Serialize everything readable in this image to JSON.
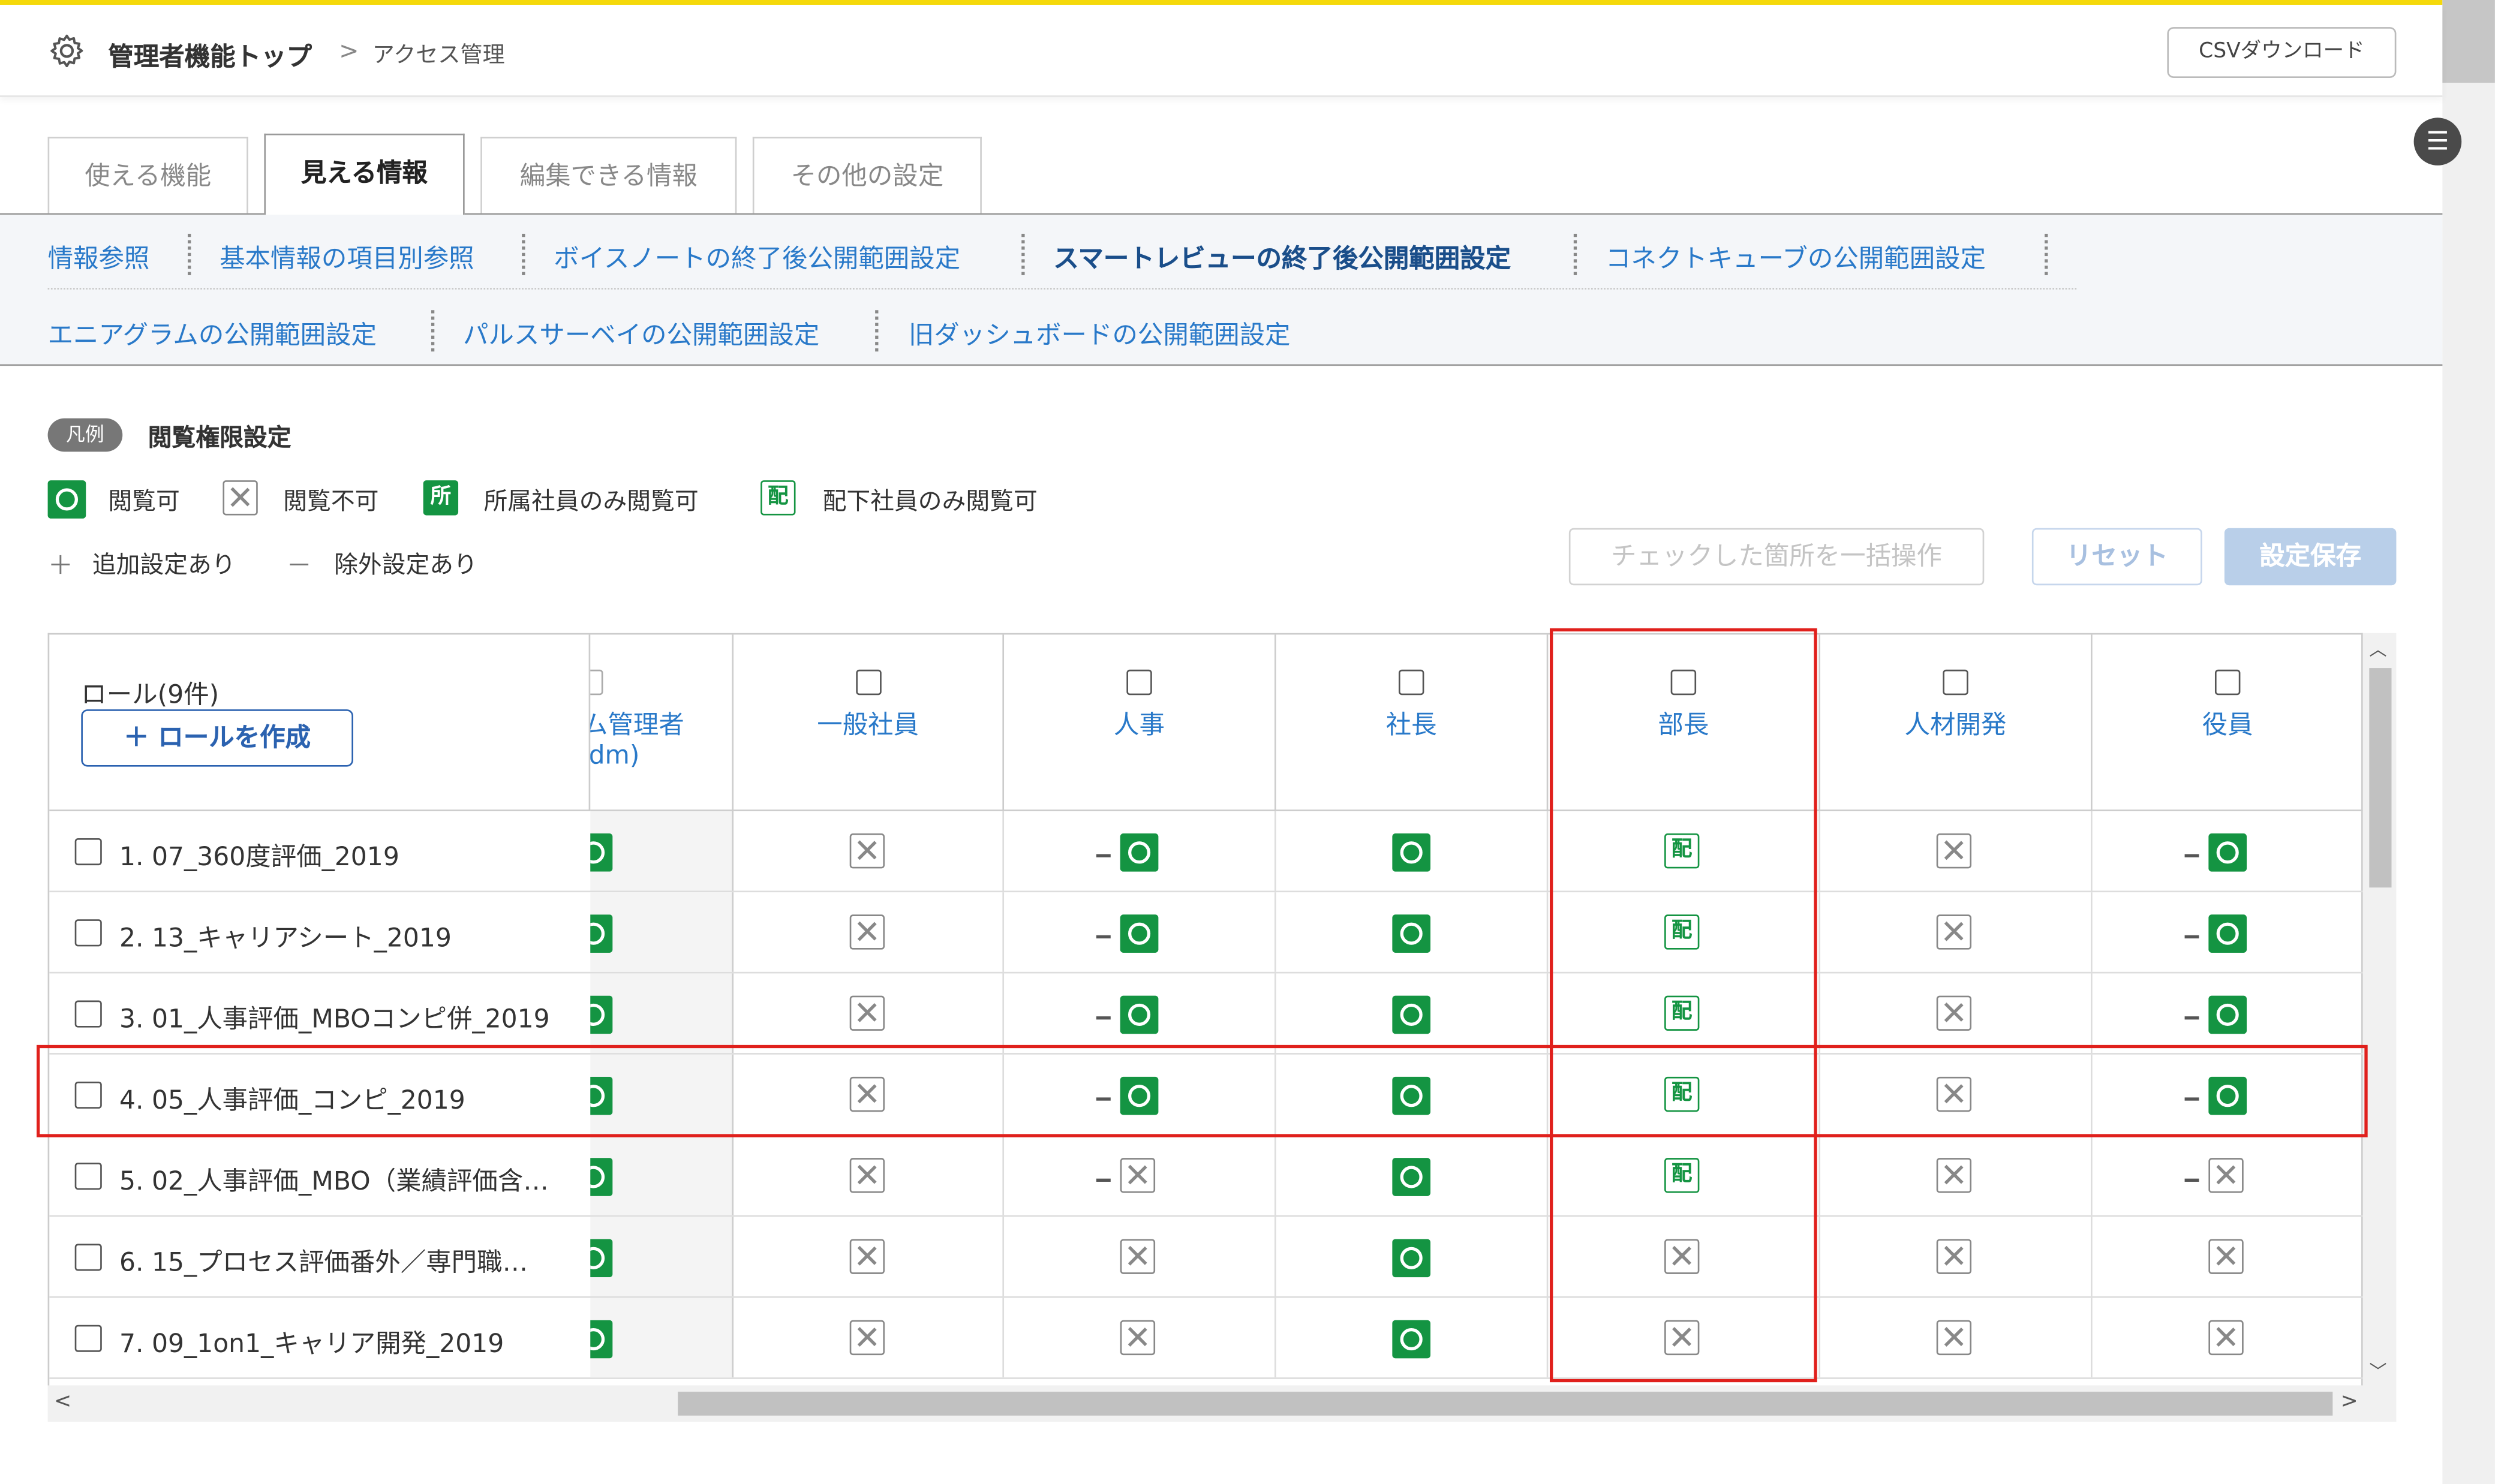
{
  "header": {
    "breadcrumb_top": "管理者機能トップ",
    "breadcrumb_sep": ">",
    "breadcrumb_current": "アクセス管理",
    "csv_button": "CSVダウンロード"
  },
  "tabs": [
    {
      "label": "使える機能",
      "active": false
    },
    {
      "label": "見える情報",
      "active": true
    },
    {
      "label": "編集できる情報",
      "active": false
    },
    {
      "label": "その他の設定",
      "active": false
    }
  ],
  "subnav": [
    {
      "label": "情報参照",
      "active": false
    },
    {
      "label": "基本情報の項目別参照",
      "active": false
    },
    {
      "label": "ボイスノートの終了後公開範囲設定",
      "active": false
    },
    {
      "label": "スマートレビューの終了後公開範囲設定",
      "active": true
    },
    {
      "label": "コネクトキューブの公開範囲設定",
      "active": false
    },
    {
      "label": "エニアグラムの公開範囲設定",
      "active": false
    },
    {
      "label": "パルスサーベイの公開範囲設定",
      "active": false
    },
    {
      "label": "旧ダッシュボードの公開範囲設定",
      "active": false
    }
  ],
  "legend": {
    "tag": "凡例",
    "title": "閲覧権限設定",
    "items": [
      {
        "icon": "view-allowed-icon",
        "label": "閲覧可"
      },
      {
        "icon": "view-denied-icon",
        "label": "閲覧不可"
      },
      {
        "icon": "affiliation-only-icon",
        "glyph": "所",
        "label": "所属社員のみ閲覧可"
      },
      {
        "icon": "subordinate-only-icon",
        "glyph": "配",
        "label": "配下社員のみ閲覧可"
      }
    ],
    "plus_symbol": "＋",
    "plus_label": "追加設定あり",
    "minus_symbol": "－",
    "minus_label": "除外設定あり"
  },
  "actions": {
    "bulk_button": "チェックした箇所を一括操作",
    "reset_button": "リセット",
    "save_button": "設定保存"
  },
  "table": {
    "role_count": "ロール(9件)",
    "create_role_button": "＋ ロールを作成",
    "partial_column": {
      "line1": "ム管理者",
      "line2": "dm)"
    },
    "columns": [
      "一般社員",
      "人事",
      "社長",
      "部長",
      "人材開発",
      "役員"
    ],
    "rows": [
      {
        "label": "1. 07_360度評価_2019",
        "cells": [
          {
            "v": "ng"
          },
          {
            "v": "ok",
            "minus": true
          },
          {
            "v": "ok"
          },
          {
            "v": "hai"
          },
          {
            "v": "ng"
          },
          {
            "v": "ok",
            "minus": true
          }
        ]
      },
      {
        "label": "2. 13_キャリアシート_2019",
        "cells": [
          {
            "v": "ng"
          },
          {
            "v": "ok",
            "minus": true
          },
          {
            "v": "ok"
          },
          {
            "v": "hai"
          },
          {
            "v": "ng"
          },
          {
            "v": "ok",
            "minus": true
          }
        ]
      },
      {
        "label": "3. 01_人事評価_MBOコンピ併_2019",
        "cells": [
          {
            "v": "ng"
          },
          {
            "v": "ok",
            "minus": true
          },
          {
            "v": "ok"
          },
          {
            "v": "hai"
          },
          {
            "v": "ng"
          },
          {
            "v": "ok",
            "minus": true
          }
        ]
      },
      {
        "label": "4. 05_人事評価_コンピ_2019",
        "cells": [
          {
            "v": "ng"
          },
          {
            "v": "ok",
            "minus": true
          },
          {
            "v": "ok"
          },
          {
            "v": "hai"
          },
          {
            "v": "ng"
          },
          {
            "v": "ok",
            "minus": true
          }
        ]
      },
      {
        "label": "5. 02_人事評価_MBO（業績評価含…",
        "cells": [
          {
            "v": "ng"
          },
          {
            "v": "ng",
            "minus": true
          },
          {
            "v": "ok"
          },
          {
            "v": "hai"
          },
          {
            "v": "ng"
          },
          {
            "v": "ng",
            "minus": true
          }
        ]
      },
      {
        "label": "6. 15_プロセス評価番外／専門職…",
        "cells": [
          {
            "v": "ng"
          },
          {
            "v": "ng"
          },
          {
            "v": "ok"
          },
          {
            "v": "ng"
          },
          {
            "v": "ng"
          },
          {
            "v": "ng"
          }
        ]
      },
      {
        "label": "7. 09_1on1_キャリア開発_2019",
        "cells": [
          {
            "v": "ng"
          },
          {
            "v": "ng"
          },
          {
            "v": "ok"
          },
          {
            "v": "ng"
          },
          {
            "v": "ng"
          },
          {
            "v": "ng"
          }
        ]
      }
    ]
  },
  "icons": {
    "gear": "gear-icon",
    "menu": "hamburger-menu-icon",
    "scroll_up": "▲",
    "scroll_down": "▼",
    "scroll_left": "<",
    "scroll_right": ">"
  },
  "colors": {
    "green": "#149442",
    "link_blue": "#2979c9",
    "highlight_red": "#e0201c",
    "top_accent": "#f5d90a"
  }
}
